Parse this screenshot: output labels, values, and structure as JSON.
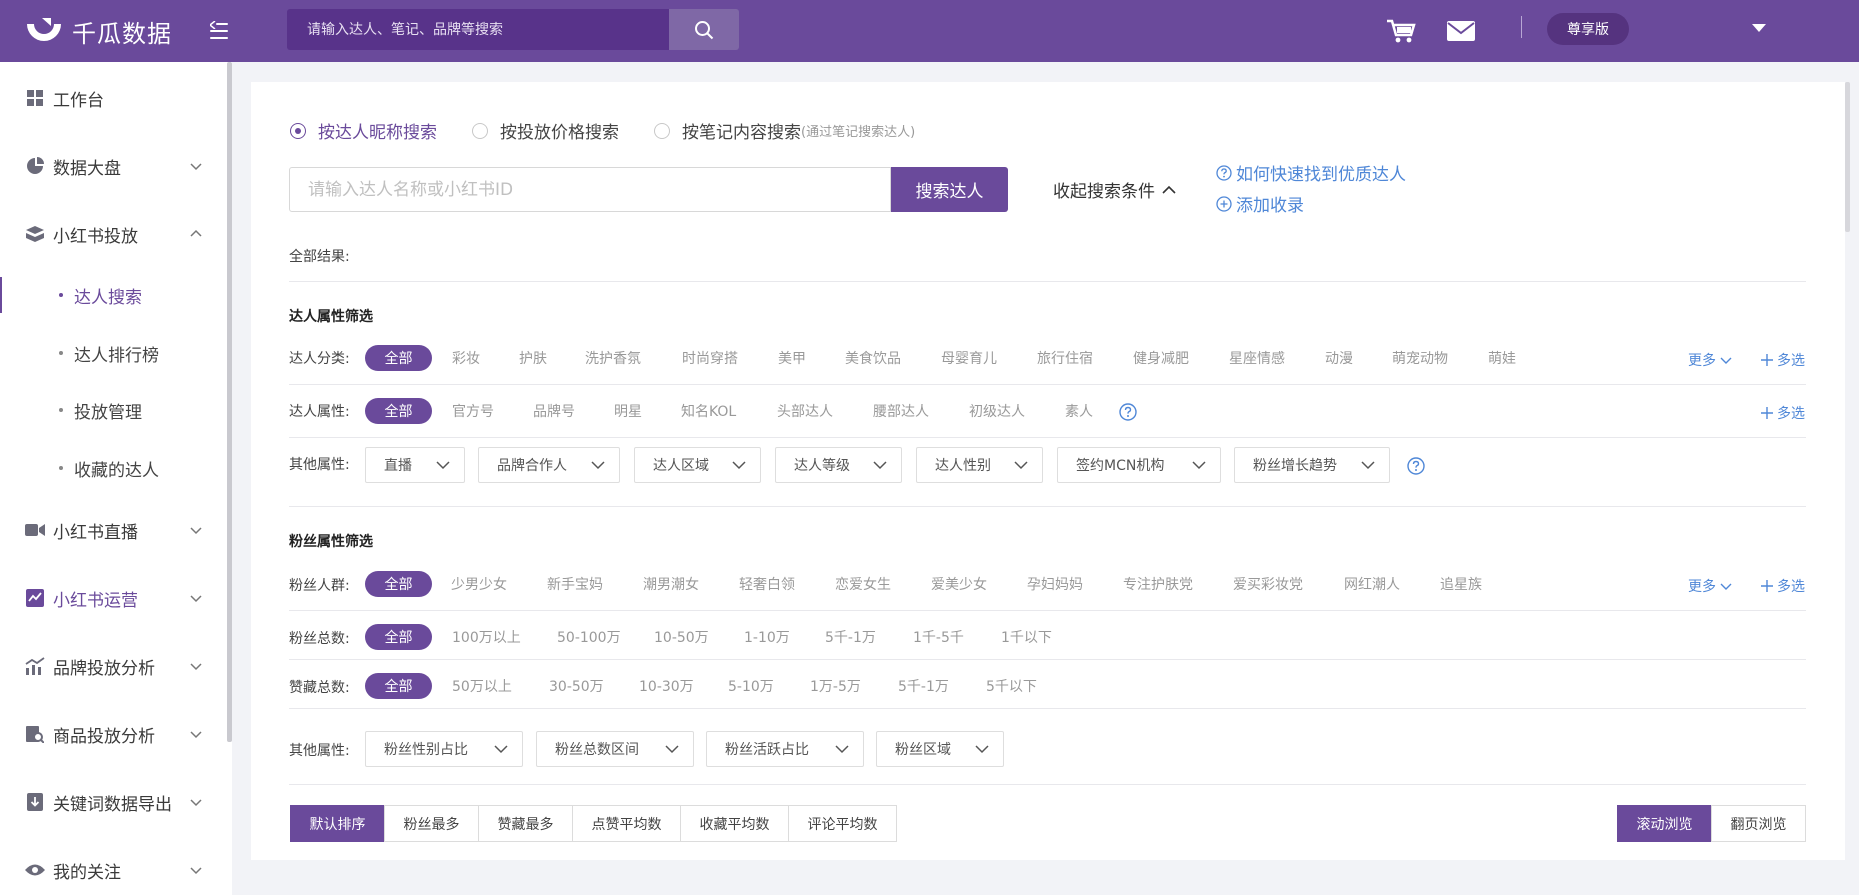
{
  "app": {
    "name": "千瓜数据"
  },
  "header": {
    "search_placeholder": "请输入达人、笔记、品牌等搜索",
    "vip_label": "尊享版"
  },
  "sidebar": {
    "items": [
      {
        "label": "工作台",
        "icon": "dashboard-icon"
      },
      {
        "label": "数据大盘",
        "icon": "pie-chart-icon"
      },
      {
        "label": "小红书投放",
        "icon": "box-icon"
      },
      {
        "label": "小红书直播",
        "icon": "video-icon"
      },
      {
        "label": "小红书运营",
        "icon": "trend-icon"
      },
      {
        "label": "品牌投放分析",
        "icon": "bar-chart-icon"
      },
      {
        "label": "商品投放分析",
        "icon": "product-search-icon"
      },
      {
        "label": "关键词数据导出",
        "icon": "download-icon"
      },
      {
        "label": "我的关注",
        "icon": "eye-icon"
      }
    ],
    "sub_items": [
      {
        "label": "达人搜索"
      },
      {
        "label": "达人排行榜"
      },
      {
        "label": "投放管理"
      },
      {
        "label": "收藏的达人"
      }
    ]
  },
  "search_mode": {
    "options": [
      {
        "label": "按达人昵称搜索",
        "hint": ""
      },
      {
        "label": "按投放价格搜索",
        "hint": ""
      },
      {
        "label": "按笔记内容搜索",
        "hint": "(通过笔记搜索达人)"
      }
    ],
    "selected": "按达人昵称搜索"
  },
  "search": {
    "placeholder": "请输入达人名称或小红书ID",
    "button": "搜索达人",
    "collapse_label": "收起搜索条件",
    "help_link": "如何快速找到优质达人",
    "add_link": "添加收录"
  },
  "results": {
    "label": "全部结果:"
  },
  "talent_filters": {
    "title": "达人属性筛选",
    "category": {
      "label": "达人分类:",
      "options": [
        "全部",
        "彩妆",
        "护肤",
        "洗护香氛",
        "时尚穿搭",
        "美甲",
        "美食饮品",
        "母婴育儿",
        "旅行住宿",
        "健身减肥",
        "星座情感",
        "动漫",
        "萌宠动物",
        "萌娃"
      ],
      "more": "更多",
      "multi": "多选"
    },
    "attribute": {
      "label": "达人属性:",
      "options": [
        "全部",
        "官方号",
        "品牌号",
        "明星",
        "知名KOL",
        "头部达人",
        "腰部达人",
        "初级达人",
        "素人"
      ],
      "multi": "多选"
    },
    "other": {
      "label": "其他属性:",
      "dropdowns": [
        "直播",
        "品牌合作人",
        "达人区域",
        "达人等级",
        "达人性别",
        "签约MCN机构",
        "粉丝增长趋势"
      ]
    }
  },
  "fan_filters": {
    "title": "粉丝属性筛选",
    "crowd": {
      "label": "粉丝人群:",
      "options": [
        "全部",
        "少男少女",
        "新手宝妈",
        "潮男潮女",
        "轻奢白领",
        "恋爱女生",
        "爱美少女",
        "孕妇妈妈",
        "专注护肤党",
        "爱买彩妆党",
        "网红潮人",
        "追星族"
      ],
      "more": "更多",
      "multi": "多选"
    },
    "total": {
      "label": "粉丝总数:",
      "options": [
        "全部",
        "100万以上",
        "50-100万",
        "10-50万",
        "1-10万",
        "5千-1万",
        "1千-5千",
        "1千以下"
      ]
    },
    "likes": {
      "label": "赞藏总数:",
      "options": [
        "全部",
        "50万以上",
        "30-50万",
        "10-30万",
        "5-10万",
        "1万-5万",
        "5千-1万",
        "5千以下"
      ]
    },
    "other": {
      "label": "其他属性:",
      "dropdowns": [
        "粉丝性别占比",
        "粉丝总数区间",
        "粉丝活跃占比",
        "粉丝区域"
      ]
    }
  },
  "sort": {
    "options": [
      "默认排序",
      "粉丝最多",
      "赞藏最多",
      "点赞平均数",
      "收藏平均数",
      "评论平均数"
    ],
    "view_options": [
      "滚动浏览",
      "翻页浏览"
    ]
  },
  "colors": {
    "brand": "#6a4a9b",
    "link": "#4f87d7"
  }
}
